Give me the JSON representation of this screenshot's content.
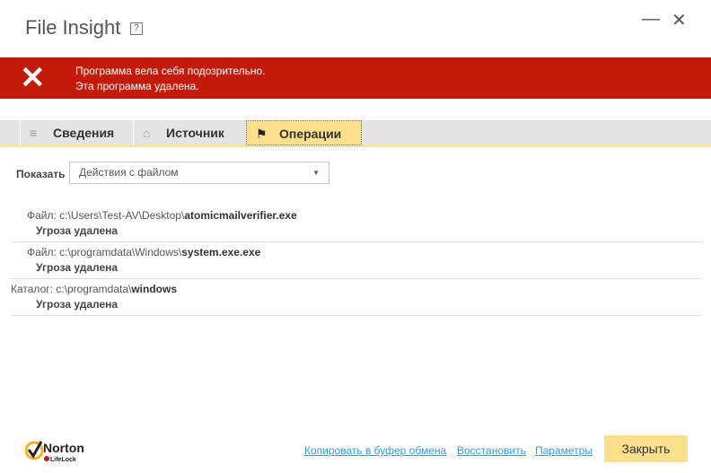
{
  "window": {
    "title": "File Insight",
    "help": "?",
    "minimize": "—",
    "close": "✕"
  },
  "banner": {
    "line1": "Программа вела себя подозрительно.",
    "line2": "Эта программа удалена.",
    "color": "#c41a09"
  },
  "tabs": [
    {
      "label": "Сведения",
      "icon": "list-icon"
    },
    {
      "label": "Источник",
      "icon": "home-icon"
    },
    {
      "label": "Операции",
      "icon": "flag-icon",
      "active": true
    }
  ],
  "filter": {
    "label": "Показать",
    "value": "Действия с файлом"
  },
  "items": [
    {
      "prefix": "Файл: c:\\Users\\Test-AV\\Desktop\\",
      "name": "atomicmailverifier.exe",
      "status": "Угроза удалена"
    },
    {
      "prefix": "Файл: c:\\programdata\\Windows\\",
      "name": "system.exe.exe",
      "status": "Угроза удалена"
    },
    {
      "prefix": "Каталог: c:\\programdata\\",
      "name": "windows",
      "status": "Угроза удалена"
    }
  ],
  "footer": {
    "logo": "Norton LifeLock",
    "copy": "Копировать в буфер обмена",
    "restore": "Восстановить",
    "settings": "Параметры",
    "close": "Закрыть"
  }
}
